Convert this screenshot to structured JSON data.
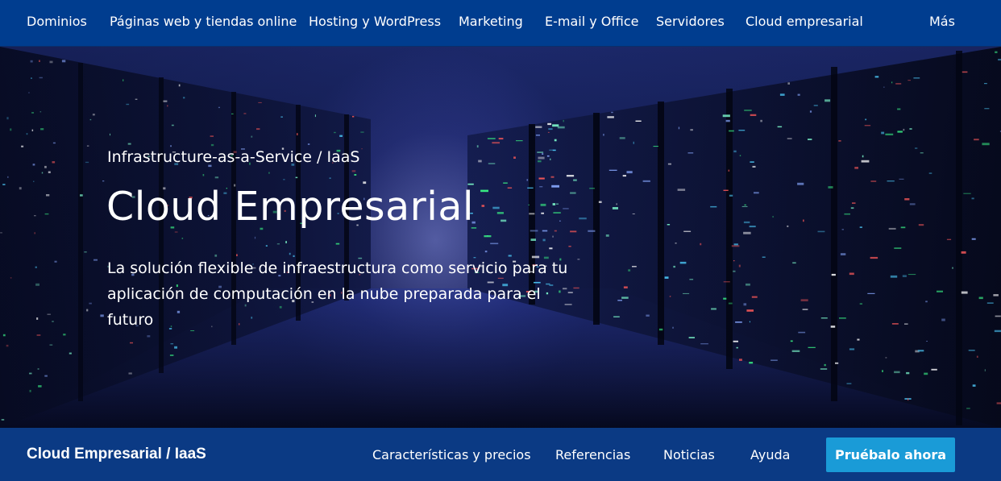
{
  "topnav": {
    "items": [
      {
        "label": "Dominios"
      },
      {
        "label": "Páginas web y tiendas online"
      },
      {
        "label": "Hosting y WordPress"
      },
      {
        "label": "Marketing"
      },
      {
        "label": "E-mail y Office"
      },
      {
        "label": "Servidores"
      },
      {
        "label": "Cloud empresarial"
      },
      {
        "label": "Más"
      }
    ]
  },
  "hero": {
    "kicker": "Infrastructure-as-a-Service / IaaS",
    "title": "Cloud Empresarial",
    "description": "La solución flexible de infraestructura como servicio para tu aplicación de computación en la nube preparada para el futuro"
  },
  "subnav": {
    "brand": "Cloud Empresarial / IaaS",
    "links": [
      {
        "label": "Características y precios"
      },
      {
        "label": "Referencias"
      },
      {
        "label": "Noticias"
      },
      {
        "label": "Ayuda"
      }
    ],
    "cta": "Pruébalo ahora"
  },
  "colors": {
    "topnav_bg": "#003d8f",
    "subnav_bg": "#0b3a84",
    "cta_bg": "#1a9bd7"
  }
}
